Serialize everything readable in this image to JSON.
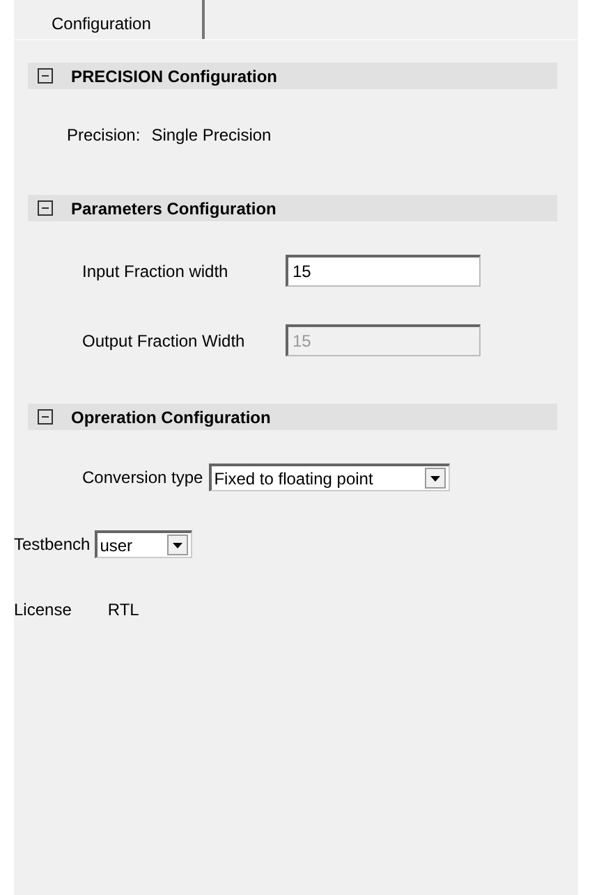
{
  "tabs": [
    {
      "label": "Configuration",
      "selected": true
    }
  ],
  "sections": [
    {
      "title": "PRECISION Configuration",
      "expanded": true,
      "rows": [
        {
          "kind": "readout",
          "label": "Precision:",
          "value": "Single Precision"
        }
      ]
    },
    {
      "title": "Parameters Configuration",
      "expanded": true,
      "rows": [
        {
          "kind": "input",
          "label": "Input Fraction width",
          "value": "15",
          "disabled": false
        },
        {
          "kind": "input",
          "label": "Output Fraction Width",
          "value": "15",
          "disabled": true
        }
      ]
    },
    {
      "title": "Opreration Configuration",
      "expanded": true,
      "rows": [
        {
          "kind": "select",
          "label": "Conversion type",
          "value": "Fixed to floating point"
        }
      ]
    }
  ],
  "testbench": {
    "label": "Testbench",
    "value": "user"
  },
  "license": {
    "label": "License",
    "value": "RTL"
  }
}
